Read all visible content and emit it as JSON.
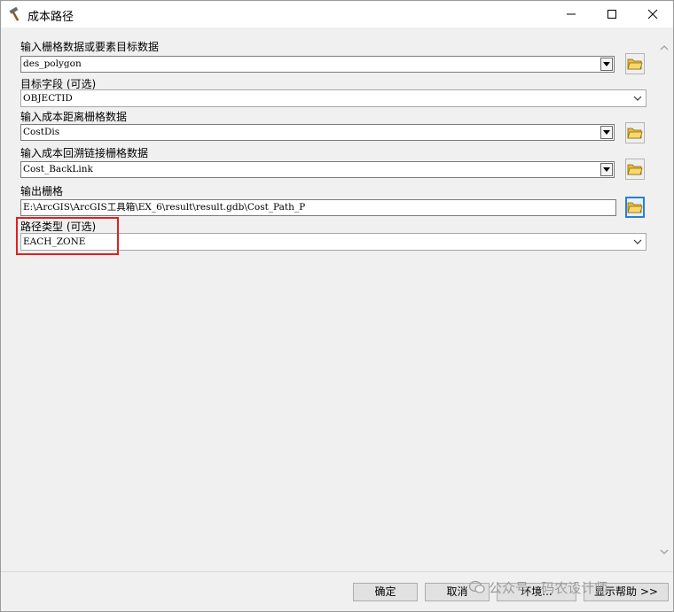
{
  "window": {
    "title": "成本路径"
  },
  "fields": {
    "input_raster": {
      "label": "输入栅格数据或要素目标数据",
      "value": "des_polygon"
    },
    "target_field": {
      "label": "目标字段 (可选)",
      "value": "OBJECTID"
    },
    "cost_distance": {
      "label": "输入成本距离栅格数据",
      "value": "CostDis"
    },
    "backlink": {
      "label": "输入成本回溯链接栅格数据",
      "value": "Cost_BackLink"
    },
    "output_raster": {
      "label": "输出栅格",
      "value": "E:\\ArcGIS\\ArcGIS工具箱\\EX_6\\result\\result.gdb\\Cost_Path_P"
    },
    "path_type": {
      "label": "路径类型 (可选)",
      "value": "EACH_ZONE"
    }
  },
  "buttons": {
    "ok": "确定",
    "cancel": "取消",
    "environments": "环境...",
    "show_help": "显示帮助 >>"
  },
  "watermark": {
    "text": "公众号 · 码农设计师"
  },
  "colors": {
    "highlight": "#e02020",
    "folder": "#f2c94c",
    "active_border": "#2a7fd6"
  }
}
